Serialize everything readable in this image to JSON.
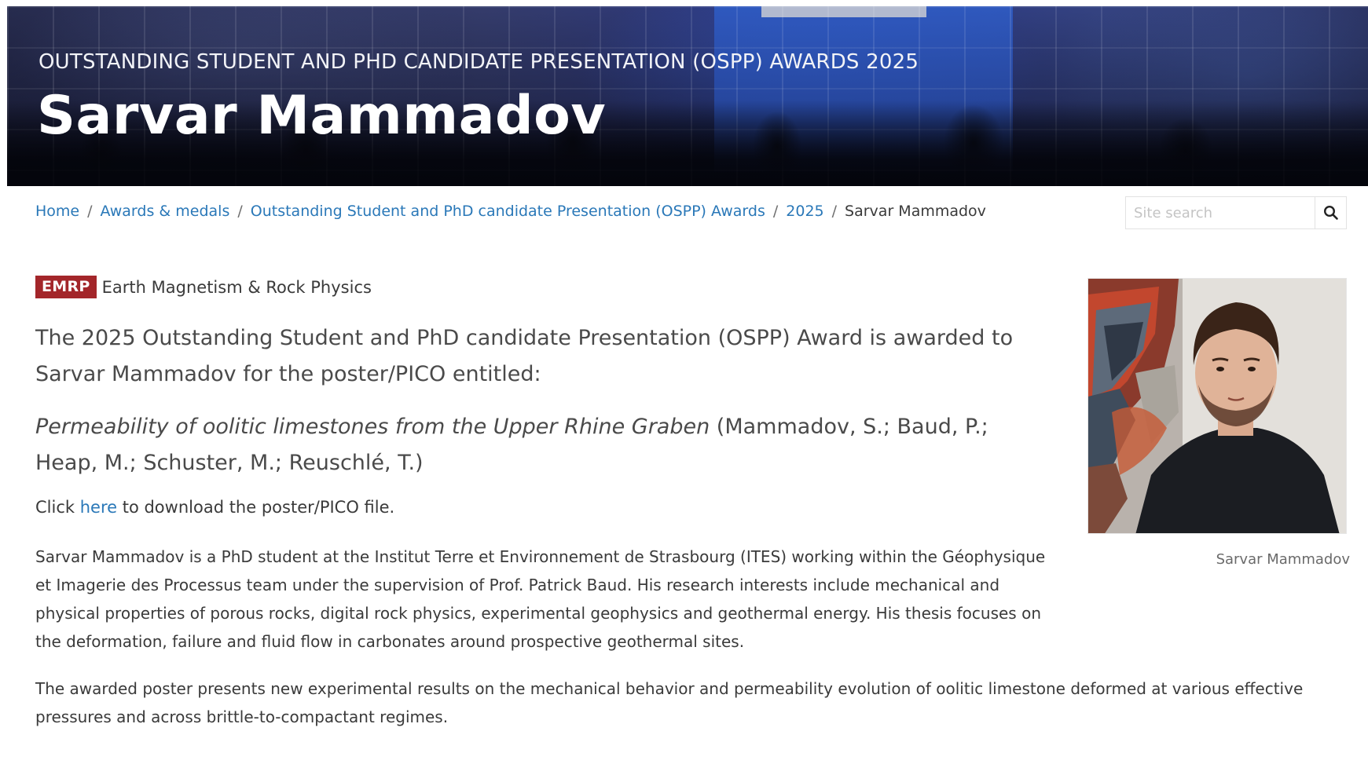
{
  "hero": {
    "subtitle": "OUTSTANDING STUDENT AND PHD CANDIDATE PRESENTATION (OSPP) AWARDS 2025",
    "title": "Sarvar Mammadov"
  },
  "breadcrumb": {
    "items": [
      "Home",
      "Awards & medals",
      "Outstanding Student and PhD candidate Presentation (OSPP) Awards",
      "2025"
    ],
    "current": "Sarvar Mammadov",
    "separator": "/"
  },
  "search": {
    "placeholder": "Site search",
    "icon": "search-icon"
  },
  "division": {
    "tag": "EMRP",
    "name": "Earth Magnetism & Rock Physics",
    "tag_color": "#a3262a"
  },
  "content": {
    "lead": "The 2025 Outstanding Student and PhD candidate Presentation (OSPP) Award is awarded to Sarvar Mammadov for the poster/PICO entitled:",
    "poster_title": "Permeability of oolitic limestones from the Upper Rhine Graben",
    "poster_authors": " (Mammadov, S.; Baud, P.; Heap, M.; Schuster, M.; Reuschlé, T.)",
    "download_prefix": "Click ",
    "download_link": "here",
    "download_suffix": " to download the poster/PICO file.",
    "bio": "Sarvar Mammadov is a PhD student at the Institut Terre et Environnement de Strasbourg (ITES) working within the Géophysique et Imagerie des Processus team under the supervision of Prof. Patrick Baud. His research interests include mechanical and physical properties of porous rocks, digital rock physics, experimental geophysics and geothermal energy. His thesis focuses on the deformation, failure and fluid flow in carbonates around prospective geothermal sites.",
    "poster_description": "The awarded poster presents new experimental results on the mechanical behavior and permeability evolution of oolitic limestone deformed at various effective pressures and across brittle-to-compactant regimes."
  },
  "portrait": {
    "caption": "Sarvar Mammadov"
  },
  "colors": {
    "link": "#2a78b8",
    "text": "#3a3a3a",
    "lead_text": "#4a4a4a"
  }
}
